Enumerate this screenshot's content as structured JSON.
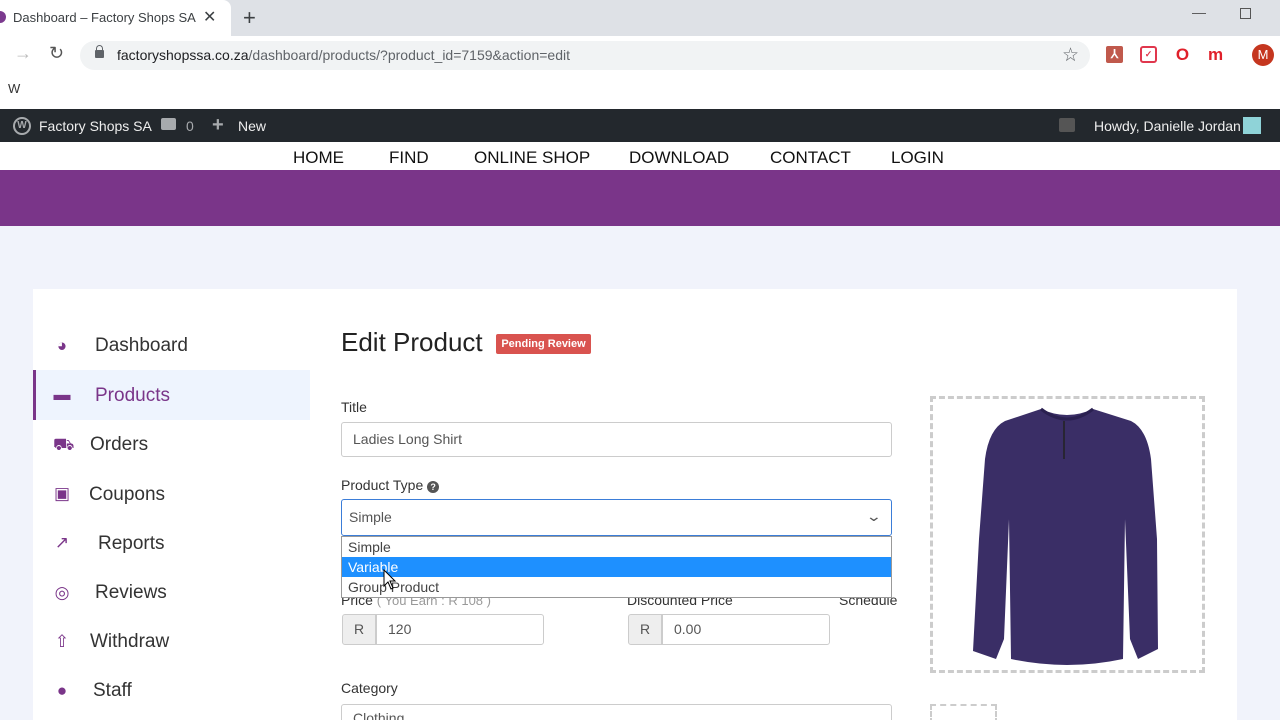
{
  "browser": {
    "tab_title": "Dashboard – Factory Shops SA",
    "url_host": "factoryshopssa.co.za",
    "url_path": "/dashboard/products/?product_id=7159&action=edit",
    "bookmark_label": "W",
    "profile_initial": "M",
    "extensions": [
      "pdf-icon",
      "pocket-icon",
      "opera-icon",
      "m-icon"
    ]
  },
  "adminbar": {
    "site_name": "Factory Shops SA",
    "comment_count": "0",
    "new_label": "New",
    "howdy": "Howdy, Danielle Jordan"
  },
  "nav": {
    "items": [
      "HOME",
      "FIND",
      "ONLINE SHOP",
      "DOWNLOAD",
      "CONTACT",
      "LOGIN"
    ]
  },
  "sidebar": {
    "items": [
      {
        "label": "Dashboard",
        "icon": "dashboard-icon"
      },
      {
        "label": "Products",
        "icon": "briefcase-icon",
        "active": true
      },
      {
        "label": "Orders",
        "icon": "cart-icon"
      },
      {
        "label": "Coupons",
        "icon": "gift-icon"
      },
      {
        "label": "Reports",
        "icon": "chart-icon"
      },
      {
        "label": "Reviews",
        "icon": "comments-icon"
      },
      {
        "label": "Withdraw",
        "icon": "upload-icon"
      },
      {
        "label": "Staff",
        "icon": "users-icon"
      }
    ]
  },
  "form": {
    "heading": "Edit Product",
    "status_badge": "Pending Review",
    "title_label": "Title",
    "title_value": "Ladies Long Shirt",
    "product_type_label": "Product Type",
    "product_type_value": "Simple",
    "product_type_options": [
      "Simple",
      "Variable",
      "Group Product"
    ],
    "highlighted_option": "Variable",
    "price_label": "Price",
    "price_hint": "( You Earn : R 108 )",
    "currency": "R",
    "price_value": "120",
    "discounted_label": "Discounted Price",
    "discounted_value": "0.00",
    "schedule_label": "Schedule",
    "category_label": "Category",
    "category_value": "Clothing"
  },
  "colors": {
    "brand_purple": "#7a3589",
    "badge_red": "#d9534f",
    "highlight_blue": "#1e90ff",
    "admin_bar": "#23282d"
  }
}
